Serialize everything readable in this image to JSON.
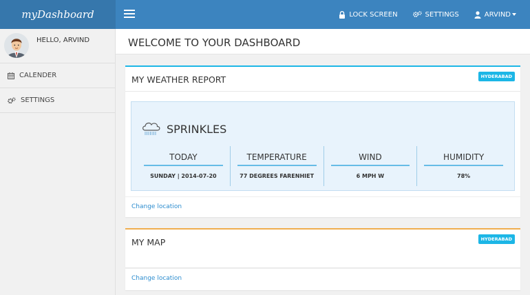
{
  "brand": "myDashboard",
  "nav": {
    "lock_screen": "LOCK SCREEN",
    "settings": "SETTINGS",
    "user": "ARVIND"
  },
  "sidebar": {
    "greeting": "HELLO, ARVIND",
    "items": [
      {
        "label": "CALENDER",
        "icon": "calendar-icon"
      },
      {
        "label": "SETTINGS",
        "icon": "gears-icon"
      }
    ]
  },
  "page": {
    "title": "WELCOME TO YOUR DASHBOARD"
  },
  "weather_panel": {
    "title": "MY WEATHER REPORT",
    "badge": "HYDERABAD",
    "condition": "SPRINKLES",
    "condition_icon": "rain-cloud-icon",
    "columns": [
      {
        "header": "TODAY",
        "value": "SUNDAY | 2014-07-20"
      },
      {
        "header": "TEMPERATURE",
        "value": "77 DEGREES FARENHIET"
      },
      {
        "header": "WIND",
        "value": "6 MPH W"
      },
      {
        "header": "HUMIDITY",
        "value": "78%"
      }
    ],
    "footer_link": "Change location",
    "accent_color": "#1cb6e6"
  },
  "map_panel": {
    "title": "MY MAP",
    "badge": "HYDERABAD",
    "footer_link": "Change location",
    "accent_color": "#f0ad4e"
  },
  "colors": {
    "topbar": "#3c84bf",
    "brand_bg": "#3677ac",
    "badge": "#1cb6e6",
    "link": "#2d8dcf"
  }
}
